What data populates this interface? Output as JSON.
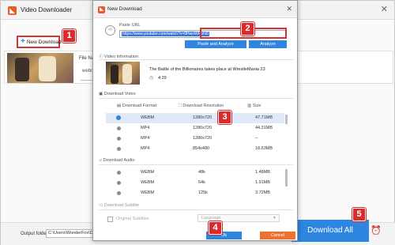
{
  "main_window": {
    "title": "Video Downloader",
    "new_download_label": "New Download",
    "file_name_label": "File Name",
    "format_text": "webm",
    "output_folder_label": "Output folder:",
    "output_folder_value": "C:\\Users\\WonderFox\\Desktop",
    "download_all_label": "Download All"
  },
  "dialog": {
    "title": "New Download",
    "paste_url_label": "Paste URL",
    "url_value": "https://www.youtube.com/watch?v=9HwnWRbND",
    "paste_analyze_label": "Paste and Analyze",
    "analyze_label": "Analyze",
    "video_info_heading": "Video Information",
    "video_title": "The Battle of the Billionaires takes place at WrestleMania 23",
    "duration": "4:29",
    "download_video_heading": "Download Video",
    "columns": {
      "format": "Download Format",
      "resolution": "Download Resolution",
      "size": "Size"
    },
    "video_rows": [
      {
        "format": "WEBM",
        "resolution": "1280x720",
        "size": "47.71MB",
        "selected": true
      },
      {
        "format": "MP4",
        "resolution": "1280x720",
        "size": "44.31MB",
        "selected": false
      },
      {
        "format": "MP4",
        "resolution": "1280x720",
        "size": "--",
        "selected": false
      },
      {
        "format": "MP4",
        "resolution": "854x480",
        "size": "18.63MB",
        "selected": false
      }
    ],
    "download_audio_heading": "Download Audio",
    "audio_rows": [
      {
        "format": "WEBM",
        "bitrate": "48k",
        "size": "1.48MB"
      },
      {
        "format": "WEBM",
        "bitrate": "64k",
        "size": "1.91MB"
      },
      {
        "format": "WEBM",
        "bitrate": "125k",
        "size": "3.72MB"
      }
    ],
    "download_subtitle_heading": "Download Subtitle",
    "original_subtitles_label": "Original Subtitles",
    "language_label": "Language",
    "ok_label": "Ok",
    "cancel_label": "Cancel"
  },
  "markers": [
    "1",
    "2",
    "3",
    "4",
    "5"
  ],
  "colors": {
    "accent_blue": "#2e86e0",
    "cancel_orange": "#f07030",
    "marker_red": "#d92b2b",
    "brand_orange": "#e85b2a"
  }
}
